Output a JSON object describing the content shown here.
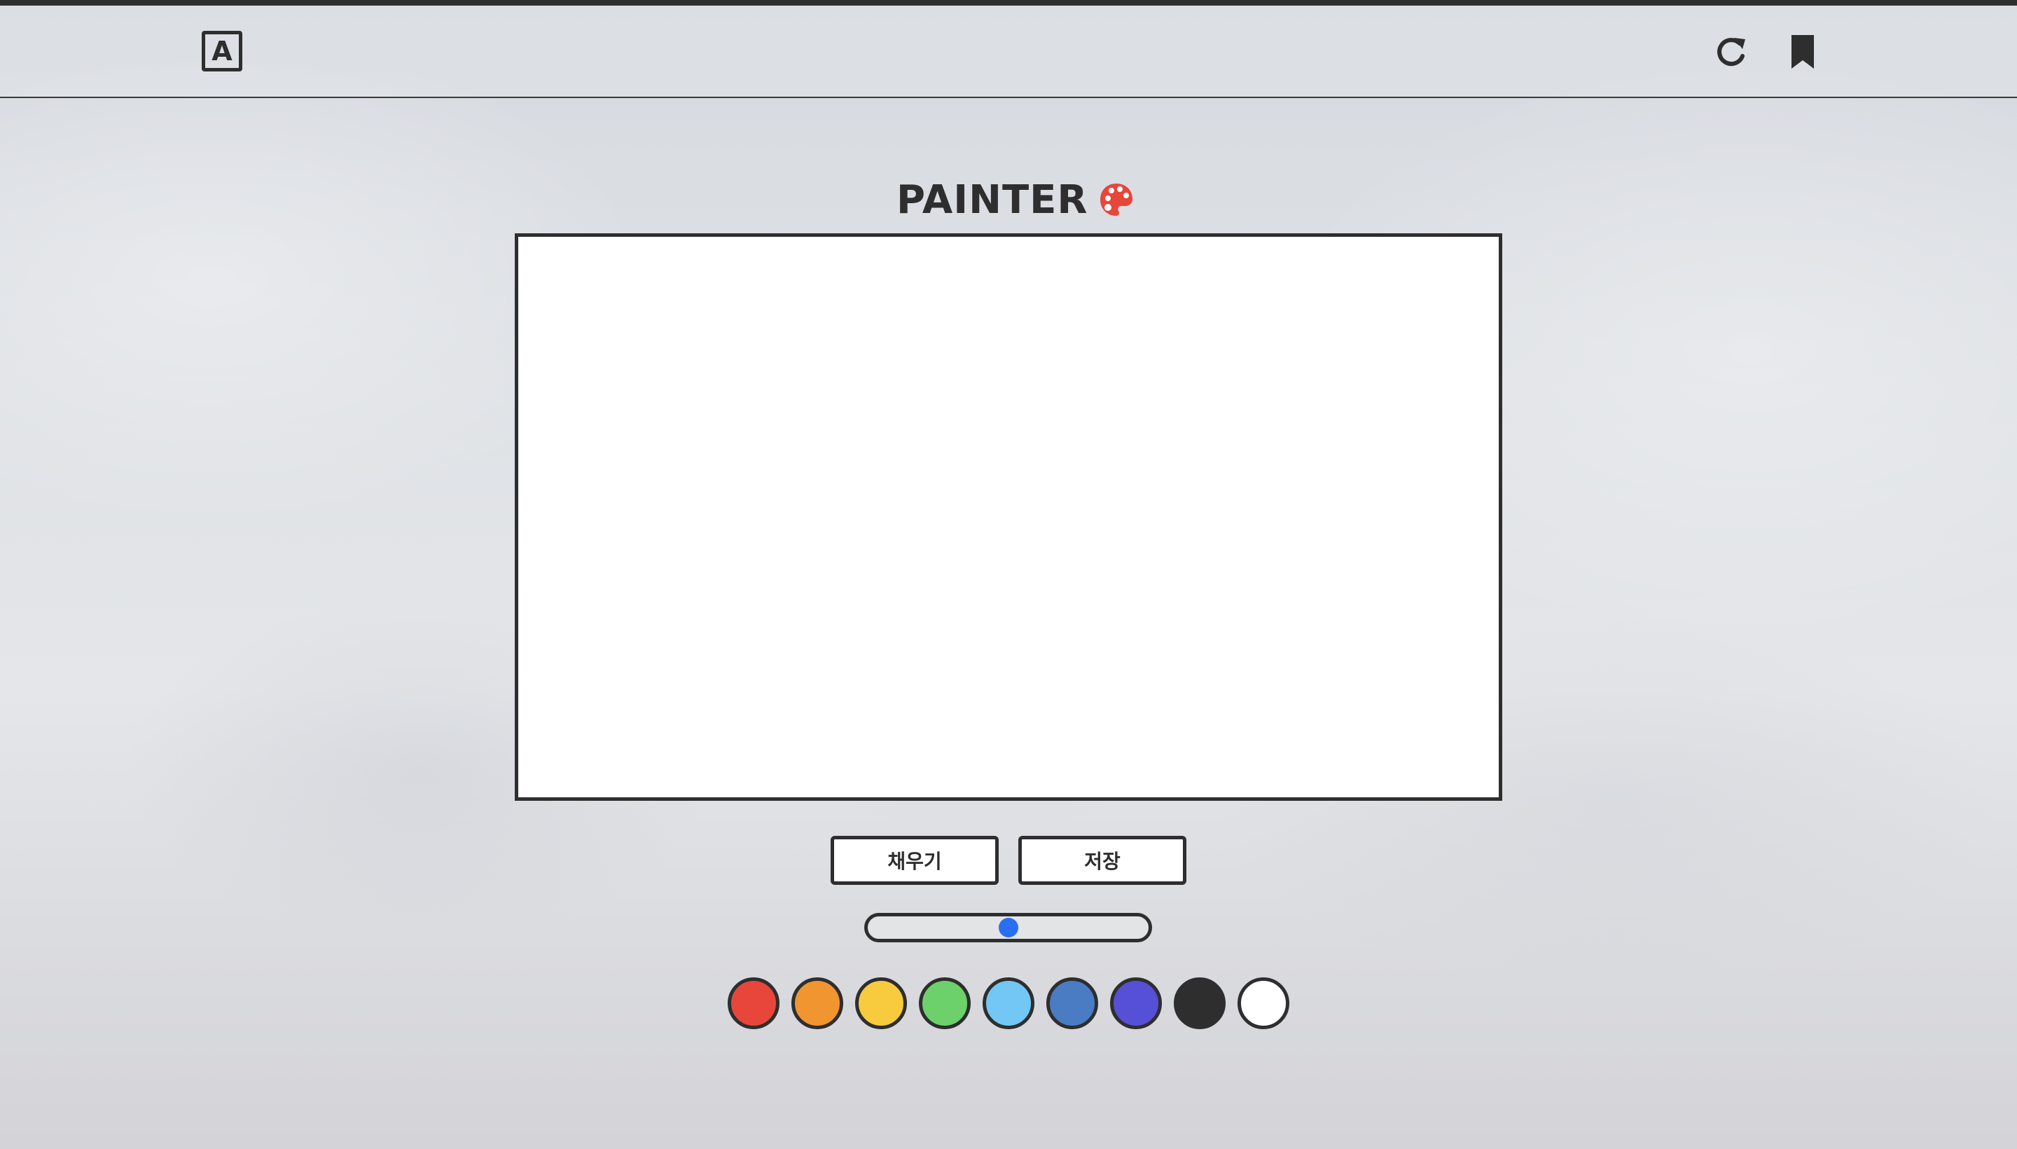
{
  "header": {
    "lang_label": "A",
    "refresh_icon": "refresh-icon",
    "bookmark_icon": "bookmark-icon"
  },
  "title": "PAINTER",
  "title_icon": "palette-icon",
  "buttons": {
    "fill_label": "채우기",
    "save_label": "저장"
  },
  "brush_size": {
    "value_fraction": 0.5,
    "thumb_color": "#2a6ef5"
  },
  "colors": [
    "#e8463a",
    "#f0952f",
    "#f7cb3d",
    "#6cd16a",
    "#72c7f5",
    "#4a7cc4",
    "#5550d6",
    "#2e2e2e",
    "#ffffff"
  ],
  "theme": {
    "outline": "#2e2e2e",
    "canvas_bg": "#ffffff"
  }
}
